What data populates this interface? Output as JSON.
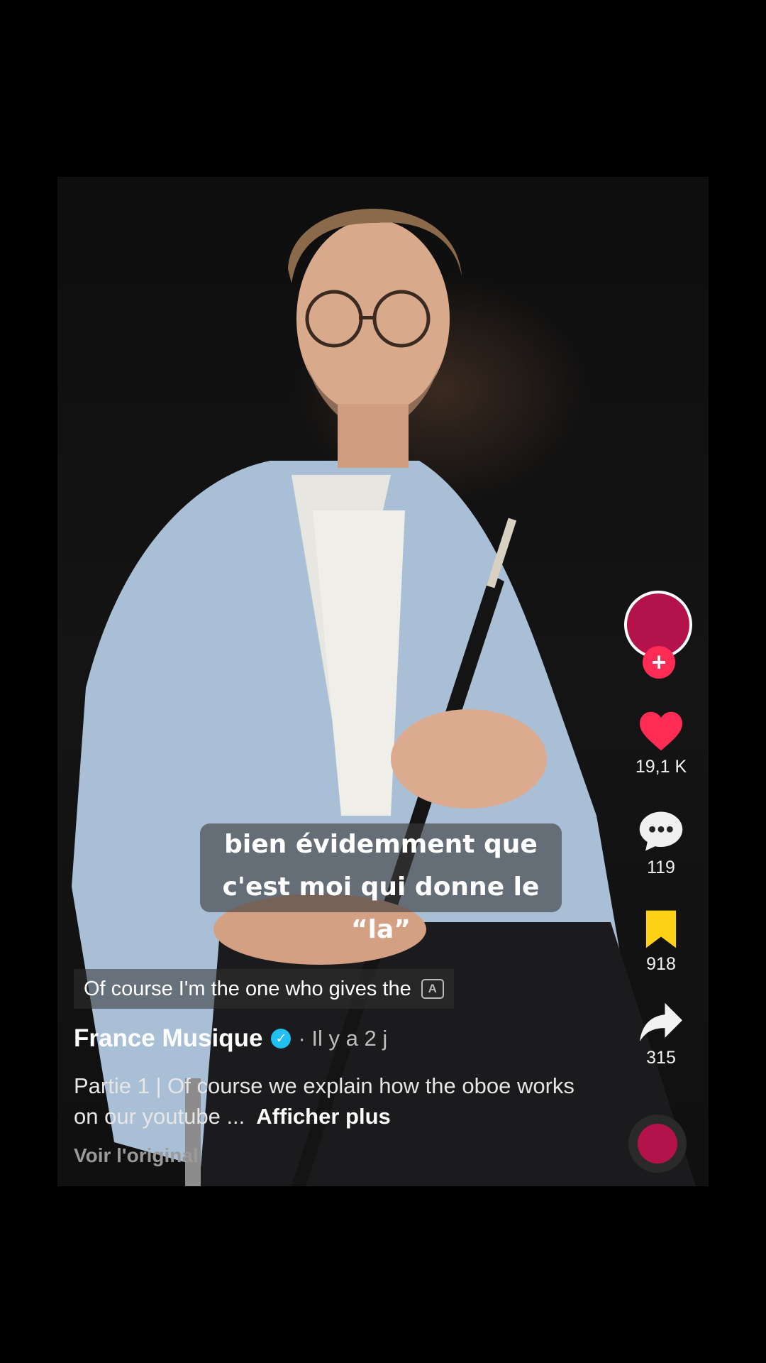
{
  "caption": {
    "line1": "bien évidemment que",
    "line2": "c'est moi qui donne le “la”"
  },
  "translation": {
    "text": "Of course I'm the one who gives the",
    "icon": "translate-icon"
  },
  "post": {
    "author": "France Musique",
    "time": "· Il y a 2 j",
    "description": "Partie 1 | Of course we explain how the oboe works on our youtube ...",
    "more_label": "Afficher plus",
    "see_original": "Voir l'original"
  },
  "actions": {
    "likes": "19,1 K",
    "comments": "119",
    "saves": "918",
    "shares": "315",
    "follow_symbol": "+"
  },
  "colors": {
    "like": "#fe2c55",
    "save": "#fcd116",
    "verified": "#20c0f0",
    "brand": "#b3134a"
  }
}
